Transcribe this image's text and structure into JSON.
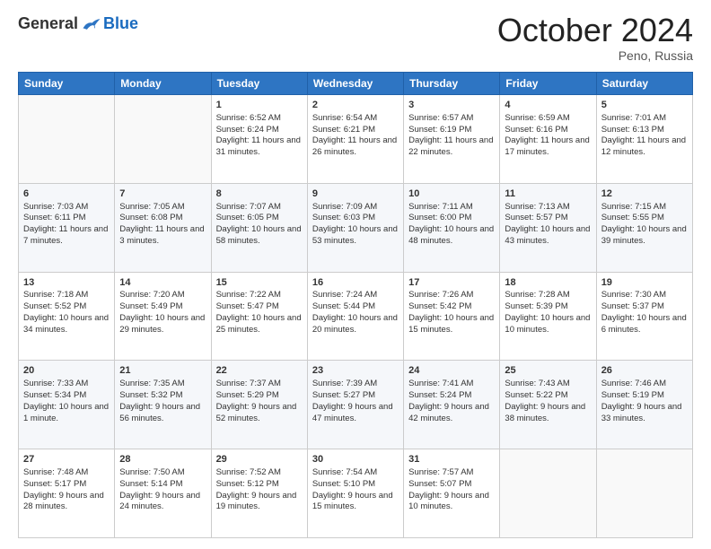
{
  "logo": {
    "general": "General",
    "blue": "Blue"
  },
  "title": "October 2024",
  "location": "Peno, Russia",
  "days_header": [
    "Sunday",
    "Monday",
    "Tuesday",
    "Wednesday",
    "Thursday",
    "Friday",
    "Saturday"
  ],
  "weeks": [
    [
      {
        "day": "",
        "sunrise": "",
        "sunset": "",
        "daylight": "",
        "empty": true
      },
      {
        "day": "",
        "sunrise": "",
        "sunset": "",
        "daylight": "",
        "empty": true
      },
      {
        "day": "1",
        "sunrise": "Sunrise: 6:52 AM",
        "sunset": "Sunset: 6:24 PM",
        "daylight": "Daylight: 11 hours and 31 minutes."
      },
      {
        "day": "2",
        "sunrise": "Sunrise: 6:54 AM",
        "sunset": "Sunset: 6:21 PM",
        "daylight": "Daylight: 11 hours and 26 minutes."
      },
      {
        "day": "3",
        "sunrise": "Sunrise: 6:57 AM",
        "sunset": "Sunset: 6:19 PM",
        "daylight": "Daylight: 11 hours and 22 minutes."
      },
      {
        "day": "4",
        "sunrise": "Sunrise: 6:59 AM",
        "sunset": "Sunset: 6:16 PM",
        "daylight": "Daylight: 11 hours and 17 minutes."
      },
      {
        "day": "5",
        "sunrise": "Sunrise: 7:01 AM",
        "sunset": "Sunset: 6:13 PM",
        "daylight": "Daylight: 11 hours and 12 minutes."
      }
    ],
    [
      {
        "day": "6",
        "sunrise": "Sunrise: 7:03 AM",
        "sunset": "Sunset: 6:11 PM",
        "daylight": "Daylight: 11 hours and 7 minutes."
      },
      {
        "day": "7",
        "sunrise": "Sunrise: 7:05 AM",
        "sunset": "Sunset: 6:08 PM",
        "daylight": "Daylight: 11 hours and 3 minutes."
      },
      {
        "day": "8",
        "sunrise": "Sunrise: 7:07 AM",
        "sunset": "Sunset: 6:05 PM",
        "daylight": "Daylight: 10 hours and 58 minutes."
      },
      {
        "day": "9",
        "sunrise": "Sunrise: 7:09 AM",
        "sunset": "Sunset: 6:03 PM",
        "daylight": "Daylight: 10 hours and 53 minutes."
      },
      {
        "day": "10",
        "sunrise": "Sunrise: 7:11 AM",
        "sunset": "Sunset: 6:00 PM",
        "daylight": "Daylight: 10 hours and 48 minutes."
      },
      {
        "day": "11",
        "sunrise": "Sunrise: 7:13 AM",
        "sunset": "Sunset: 5:57 PM",
        "daylight": "Daylight: 10 hours and 43 minutes."
      },
      {
        "day": "12",
        "sunrise": "Sunrise: 7:15 AM",
        "sunset": "Sunset: 5:55 PM",
        "daylight": "Daylight: 10 hours and 39 minutes."
      }
    ],
    [
      {
        "day": "13",
        "sunrise": "Sunrise: 7:18 AM",
        "sunset": "Sunset: 5:52 PM",
        "daylight": "Daylight: 10 hours and 34 minutes."
      },
      {
        "day": "14",
        "sunrise": "Sunrise: 7:20 AM",
        "sunset": "Sunset: 5:49 PM",
        "daylight": "Daylight: 10 hours and 29 minutes."
      },
      {
        "day": "15",
        "sunrise": "Sunrise: 7:22 AM",
        "sunset": "Sunset: 5:47 PM",
        "daylight": "Daylight: 10 hours and 25 minutes."
      },
      {
        "day": "16",
        "sunrise": "Sunrise: 7:24 AM",
        "sunset": "Sunset: 5:44 PM",
        "daylight": "Daylight: 10 hours and 20 minutes."
      },
      {
        "day": "17",
        "sunrise": "Sunrise: 7:26 AM",
        "sunset": "Sunset: 5:42 PM",
        "daylight": "Daylight: 10 hours and 15 minutes."
      },
      {
        "day": "18",
        "sunrise": "Sunrise: 7:28 AM",
        "sunset": "Sunset: 5:39 PM",
        "daylight": "Daylight: 10 hours and 10 minutes."
      },
      {
        "day": "19",
        "sunrise": "Sunrise: 7:30 AM",
        "sunset": "Sunset: 5:37 PM",
        "daylight": "Daylight: 10 hours and 6 minutes."
      }
    ],
    [
      {
        "day": "20",
        "sunrise": "Sunrise: 7:33 AM",
        "sunset": "Sunset: 5:34 PM",
        "daylight": "Daylight: 10 hours and 1 minute."
      },
      {
        "day": "21",
        "sunrise": "Sunrise: 7:35 AM",
        "sunset": "Sunset: 5:32 PM",
        "daylight": "Daylight: 9 hours and 56 minutes."
      },
      {
        "day": "22",
        "sunrise": "Sunrise: 7:37 AM",
        "sunset": "Sunset: 5:29 PM",
        "daylight": "Daylight: 9 hours and 52 minutes."
      },
      {
        "day": "23",
        "sunrise": "Sunrise: 7:39 AM",
        "sunset": "Sunset: 5:27 PM",
        "daylight": "Daylight: 9 hours and 47 minutes."
      },
      {
        "day": "24",
        "sunrise": "Sunrise: 7:41 AM",
        "sunset": "Sunset: 5:24 PM",
        "daylight": "Daylight: 9 hours and 42 minutes."
      },
      {
        "day": "25",
        "sunrise": "Sunrise: 7:43 AM",
        "sunset": "Sunset: 5:22 PM",
        "daylight": "Daylight: 9 hours and 38 minutes."
      },
      {
        "day": "26",
        "sunrise": "Sunrise: 7:46 AM",
        "sunset": "Sunset: 5:19 PM",
        "daylight": "Daylight: 9 hours and 33 minutes."
      }
    ],
    [
      {
        "day": "27",
        "sunrise": "Sunrise: 7:48 AM",
        "sunset": "Sunset: 5:17 PM",
        "daylight": "Daylight: 9 hours and 28 minutes."
      },
      {
        "day": "28",
        "sunrise": "Sunrise: 7:50 AM",
        "sunset": "Sunset: 5:14 PM",
        "daylight": "Daylight: 9 hours and 24 minutes."
      },
      {
        "day": "29",
        "sunrise": "Sunrise: 7:52 AM",
        "sunset": "Sunset: 5:12 PM",
        "daylight": "Daylight: 9 hours and 19 minutes."
      },
      {
        "day": "30",
        "sunrise": "Sunrise: 7:54 AM",
        "sunset": "Sunset: 5:10 PM",
        "daylight": "Daylight: 9 hours and 15 minutes."
      },
      {
        "day": "31",
        "sunrise": "Sunrise: 7:57 AM",
        "sunset": "Sunset: 5:07 PM",
        "daylight": "Daylight: 9 hours and 10 minutes."
      },
      {
        "day": "",
        "sunrise": "",
        "sunset": "",
        "daylight": "",
        "empty": true
      },
      {
        "day": "",
        "sunrise": "",
        "sunset": "",
        "daylight": "",
        "empty": true
      }
    ]
  ]
}
